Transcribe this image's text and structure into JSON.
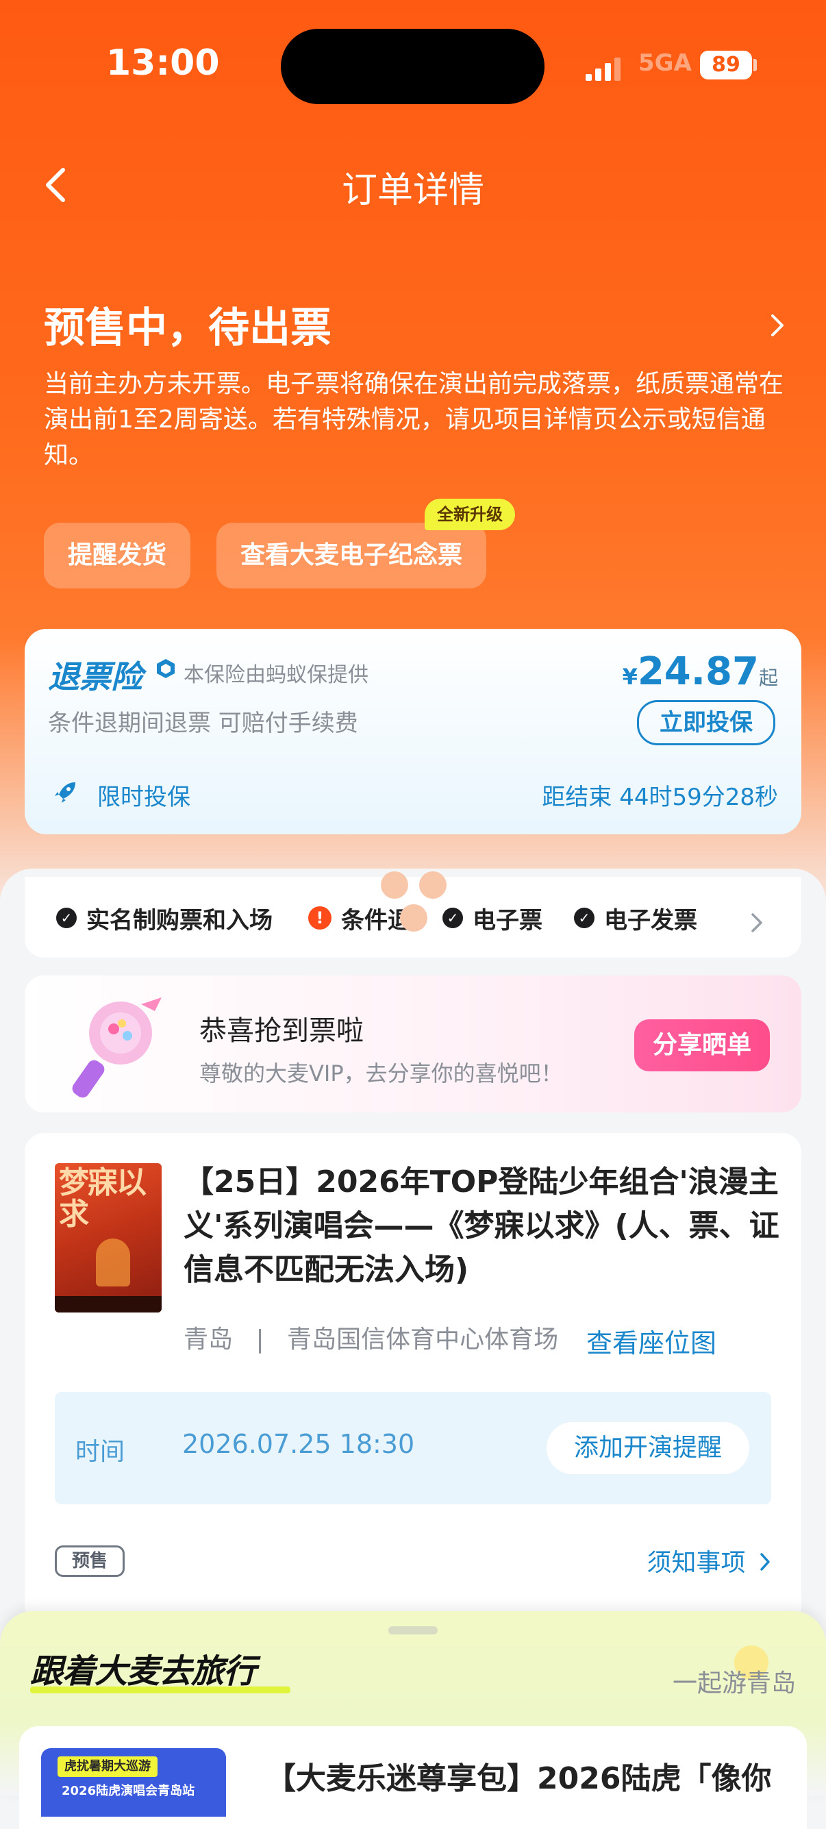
{
  "status_bar": {
    "time": "13:00",
    "network": "5GA",
    "battery": "89"
  },
  "nav": {
    "title": "订单详情"
  },
  "status": {
    "title": "预售中，待出票",
    "desc": "当前主办方未开票。电子票将确保在演出前完成落票，纸质票通常在演出前1至2周寄送。若有特殊情况，请见项目详情页公示或短信通知。"
  },
  "actions": {
    "remind": "提醒发货",
    "souvenir": "查看大麦电子纪念票",
    "new_badge": "全新升级"
  },
  "insurance": {
    "name": "退票险",
    "provider": "本保险由蚂蚁保提供",
    "subtitle": "条件退期间退票 可赔付手续费",
    "currency": "¥",
    "price": "24.87",
    "price_suffix": "起",
    "button": "立即投保",
    "limited": "限时投保",
    "countdown": "距结束 44时59分28秒"
  },
  "tags": [
    {
      "label": "实名制购票和入场",
      "type": "check"
    },
    {
      "label": "条件退",
      "type": "warn"
    },
    {
      "label": "电子票",
      "type": "check"
    },
    {
      "label": "电子发票",
      "type": "check"
    }
  ],
  "congrats": {
    "title": "恭喜抢到票啦",
    "subtitle": "尊敬的大麦VIP，去分享你的喜悦吧！",
    "button": "分享晒单"
  },
  "order": {
    "poster_text": "梦寐以求",
    "title": "【25日】2026年TOP登陆少年组合'浪漫主义'系列演唱会——《梦寐以求》(人、票、证信息不匹配无法入场)",
    "city": "青岛",
    "separator": "|",
    "venue": "青岛国信体育中心体育场",
    "seat_map": "查看座位图",
    "time_label": "时间",
    "time_value": "2026.07.25 18:30",
    "reminder_button": "添加开演提醒",
    "presale_tag": "预售",
    "notice": "须知事项"
  },
  "travel": {
    "title": "跟着大麦去旅行",
    "subtitle": "一起游青岛"
  },
  "package": {
    "img_tag": "虎扰暑期大巡游",
    "img_text": "2026陆虎演唱会青岛站",
    "title": "【大麦乐迷尊享包】2026陆虎「像你"
  },
  "colors": {
    "brand_orange": "#ff5a12",
    "accent_blue": "#1a87cc",
    "pink": "#ff4d8b",
    "lime": "#dff43a"
  },
  "icons": [
    "back-arrow-icon",
    "chevron-right-icon",
    "shield-badge-icon",
    "rocket-icon",
    "check-circle-icon",
    "warning-circle-icon",
    "signal-icon",
    "battery-icon"
  ]
}
